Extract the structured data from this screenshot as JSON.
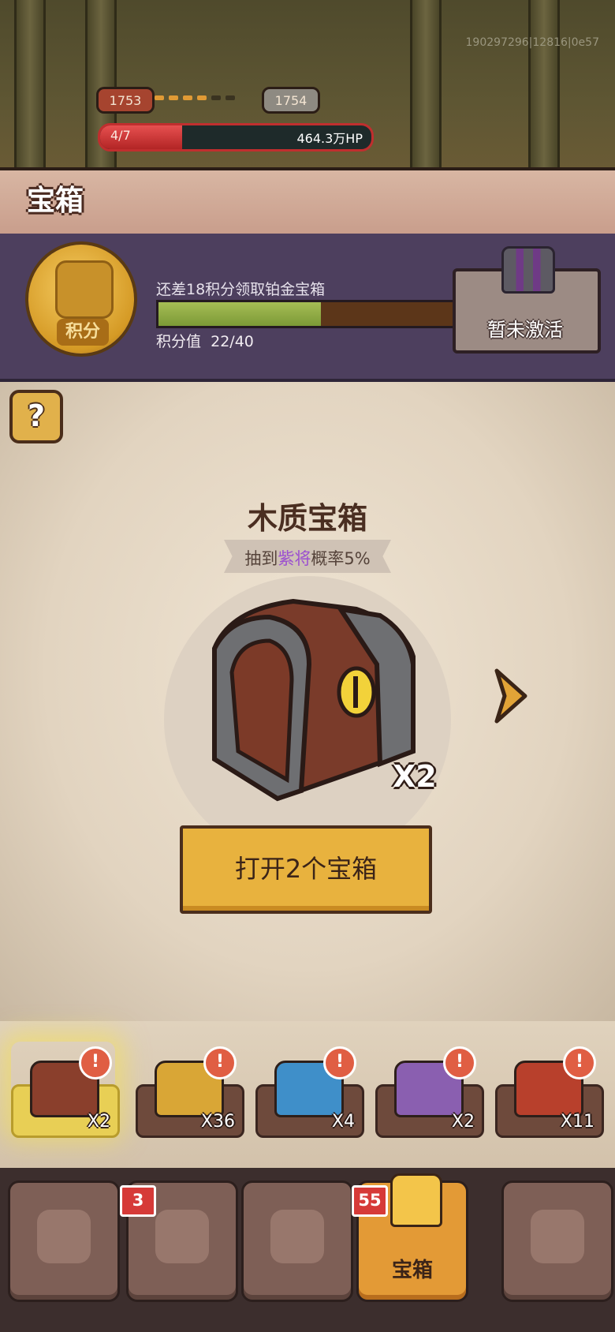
{
  "debug_text": "190297296|12816|0e57",
  "level": {
    "current": "1753",
    "next": "1754"
  },
  "hp": {
    "stage": "4/7",
    "value": "464.3万HP"
  },
  "page_title": "宝箱",
  "points": {
    "medal_label": "积分",
    "message": "还差18积分领取铂金宝箱",
    "value_label": "积分值",
    "value": "22/40",
    "progress": 0.55,
    "reward_status": "暂未激活"
  },
  "help_label": "?",
  "chest": {
    "title": "木质宝箱",
    "odds_prefix": "抽到",
    "odds_highlight": "紫将",
    "odds_suffix": "概率5%",
    "count": "X2",
    "open_button": "打开2个宝箱"
  },
  "chest_slots": [
    {
      "count": "X2",
      "badge": "!",
      "color": "#8a3f2c"
    },
    {
      "count": "X36",
      "badge": "!",
      "color": "#d9a636"
    },
    {
      "count": "X4",
      "badge": "!",
      "color": "#3f8fc9"
    },
    {
      "count": "X2",
      "badge": "!",
      "color": "#8a5fb0"
    },
    {
      "count": "X11",
      "badge": "!",
      "color": "#b8402c"
    }
  ],
  "nav": {
    "tabs": [
      {
        "label": "",
        "badge": ""
      },
      {
        "label": "",
        "badge": "3"
      },
      {
        "label": "",
        "badge": ""
      },
      {
        "label": "宝箱",
        "badge": "55"
      },
      {
        "label": "",
        "badge": ""
      }
    ]
  },
  "colors": {
    "accent": "#e39a36",
    "highlight": "#9b4fd0",
    "hp": "#c02e2e"
  }
}
